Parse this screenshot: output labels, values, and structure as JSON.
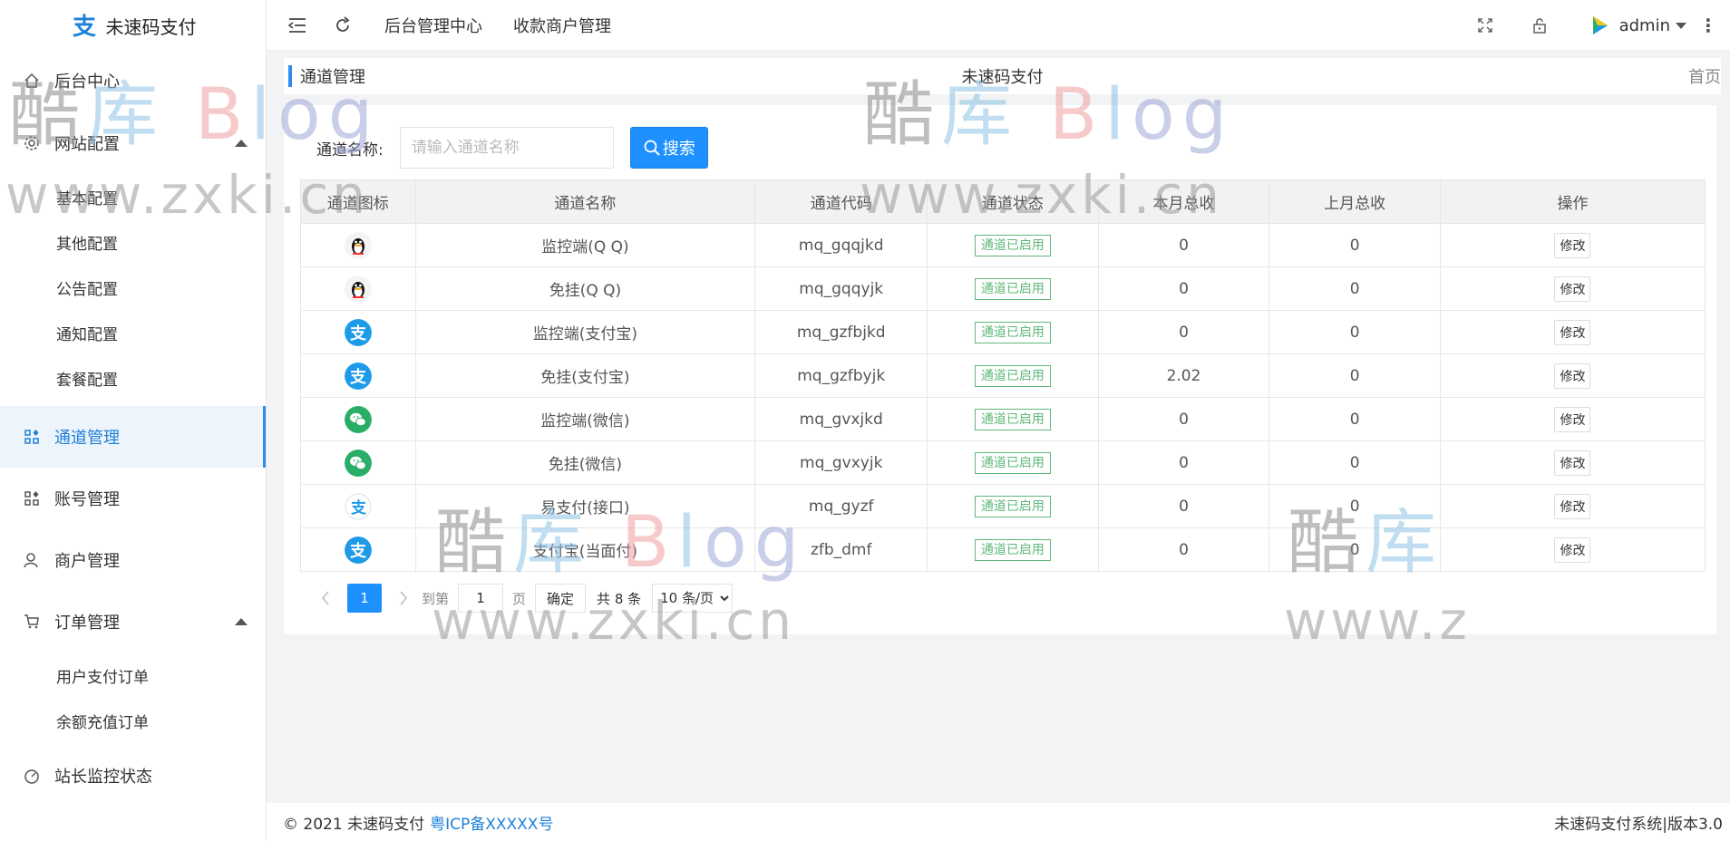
{
  "app": {
    "title": "未速码支付"
  },
  "sidebar": {
    "items": [
      {
        "label": "后台中心",
        "icon": "home-icon"
      },
      {
        "label": "网站配置",
        "icon": "gear-icon",
        "expanded": true,
        "children": [
          "基本配置",
          "其他配置",
          "公告配置",
          "通知配置",
          "套餐配置"
        ]
      },
      {
        "label": "通道管理",
        "icon": "grid-icon",
        "active": true
      },
      {
        "label": "账号管理",
        "icon": "grid-icon"
      },
      {
        "label": "商户管理",
        "icon": "user-icon"
      },
      {
        "label": "订单管理",
        "icon": "cart-icon",
        "expanded": true,
        "children": [
          "用户支付订单",
          "余额充值订单"
        ]
      },
      {
        "label": "站长监控状态",
        "icon": "gauge-icon"
      }
    ]
  },
  "header": {
    "links": [
      "后台管理中心",
      "收款商户管理"
    ],
    "user": "admin"
  },
  "breadcrumb": {
    "title": "通道管理",
    "center": "未速码支付",
    "home": "首页"
  },
  "search": {
    "label": "通道名称:",
    "placeholder": "请输入通道名称",
    "button": "搜索"
  },
  "table": {
    "headers": [
      "通道图标",
      "通道名称",
      "通道代码",
      "通道状态",
      "本月总收",
      "上月总收",
      "操作"
    ],
    "rows": [
      {
        "icon": "qq",
        "name": "监控端(Q Q)",
        "code": "mq_gqqjkd",
        "status": "通道已启用",
        "this_month": "0",
        "last_month": "0",
        "action": "修改"
      },
      {
        "icon": "qq",
        "name": "免挂(Q Q)",
        "code": "mq_gqqyjk",
        "status": "通道已启用",
        "this_month": "0",
        "last_month": "0",
        "action": "修改"
      },
      {
        "icon": "alipay",
        "name": "监控端(支付宝)",
        "code": "mq_gzfbjkd",
        "status": "通道已启用",
        "this_month": "0",
        "last_month": "0",
        "action": "修改"
      },
      {
        "icon": "alipay",
        "name": "免挂(支付宝)",
        "code": "mq_gzfbyjk",
        "status": "通道已启用",
        "this_month": "2.02",
        "last_month": "0",
        "action": "修改"
      },
      {
        "icon": "wechat",
        "name": "监控端(微信)",
        "code": "mq_gvxjkd",
        "status": "通道已启用",
        "this_month": "0",
        "last_month": "0",
        "action": "修改"
      },
      {
        "icon": "wechat",
        "name": "免挂(微信)",
        "code": "mq_gvxyjk",
        "status": "通道已启用",
        "this_month": "0",
        "last_month": "0",
        "action": "修改"
      },
      {
        "icon": "yizhifu",
        "name": "易支付(接口)",
        "code": "mq_gyzf",
        "status": "通道已启用",
        "this_month": "0",
        "last_month": "0",
        "action": "修改"
      },
      {
        "icon": "alipay",
        "name": "支付宝(当面付)",
        "code": "zfb_dmf",
        "status": "通道已启用",
        "this_month": "0",
        "last_month": "0",
        "action": "修改"
      }
    ]
  },
  "pager": {
    "current": "1",
    "goto_label": "到第",
    "goto_value": "1",
    "page_label": "页",
    "ok": "确定",
    "total": "共 8 条",
    "page_size": "10 条/页"
  },
  "footer": {
    "copyright": "© 2021 未速码支付",
    "icp": "粤ICP备XXXXX号",
    "version": "未速码支付系统|版本3.0"
  },
  "watermark": {
    "logo_char1": "酷",
    "logo_char2": "库",
    "logo_b": "B",
    "logo_l": "l",
    "logo_og": "og",
    "url": "www.zxki.cn",
    "url_partial": "www.z"
  },
  "colors": {
    "accent": "#1e90ff",
    "status": "#5fb878",
    "qq": "#111111",
    "alipay": "#1e9be8",
    "wechat": "#2aae67"
  }
}
